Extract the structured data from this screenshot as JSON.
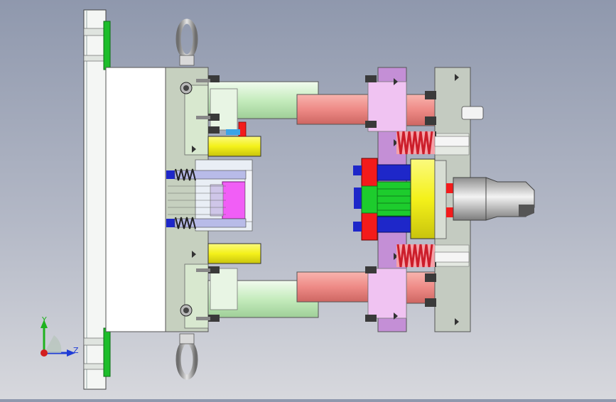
{
  "viewport": {
    "background_top": "#8f98ad",
    "background_bottom": "#d7d8dd"
  },
  "triad": {
    "y_label": "Y",
    "z_label": "Z",
    "y_color": "#1fb21f",
    "z_color": "#1f3cd6",
    "x_color": "#d21f1f"
  },
  "colors": {
    "back_plate": "#f4f6f4",
    "clamp_green": "#1dbd2a",
    "bolster": "#c6d0bf",
    "guide_pillar": "#cfefc9",
    "guide_bushing": "#ee8a86",
    "stripper_plate": "#c48fd6",
    "end_plate": "#c4cbc1",
    "spring_red": "#cc1d2a",
    "yellow_block": "#f4f11a",
    "red_block": "#f31b1b",
    "blue_part": "#1e27c9",
    "magenta_insert": "#f15ef6",
    "green_insert": "#1dcc2d",
    "shank_grey": "#c9c9c9"
  }
}
